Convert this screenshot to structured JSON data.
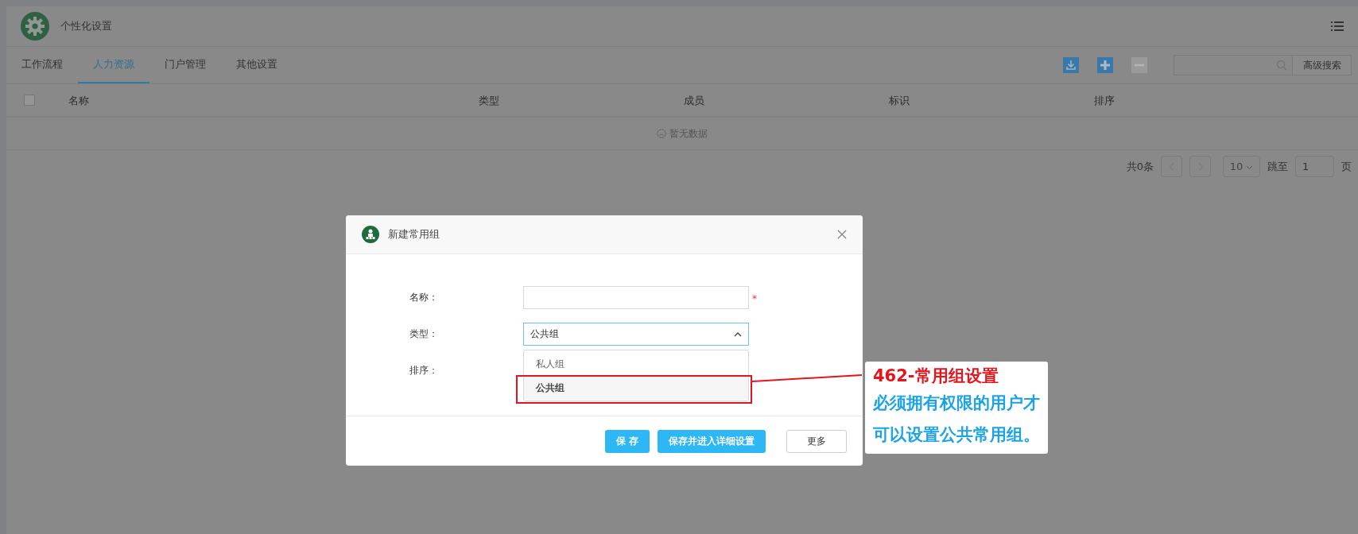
{
  "header": {
    "title": "个性化设置"
  },
  "tabs": [
    {
      "label": "工作流程",
      "selected": false
    },
    {
      "label": "人力资源",
      "selected": true
    },
    {
      "label": "门户管理",
      "selected": false
    },
    {
      "label": "其他设置",
      "selected": false
    }
  ],
  "toolbar": {
    "advanced_search": "高级搜索"
  },
  "table": {
    "select_all": {
      "checked": false
    },
    "columns": [
      "名称",
      "类型",
      "成员",
      "标识",
      "排序"
    ],
    "empty_text": "暂无数据"
  },
  "pagination": {
    "total": "共0条",
    "page_size": "10",
    "jump_label": "跳至",
    "page": "1",
    "page_suffix": "页"
  },
  "dialog": {
    "title": "新建常用组",
    "fields": [
      {
        "label": "名称：",
        "kind": "text",
        "required_mark": "*"
      },
      {
        "label": "类型：",
        "kind": "select",
        "value": "公共组",
        "expanded": true,
        "options": [
          {
            "label": "私人组",
            "selected": false
          },
          {
            "label": "公共组",
            "selected": true
          }
        ]
      },
      {
        "label": "排序：",
        "kind": "covered"
      }
    ],
    "buttons": [
      {
        "label": "保 存",
        "kind": "primary"
      },
      {
        "label": "保存并进入详细设置",
        "kind": "primary"
      },
      {
        "label": "更多",
        "kind": "plain"
      }
    ]
  },
  "annotation": {
    "title": "462-常用组设置",
    "lines": [
      "必须拥有权限的用户才",
      "可以设置公共常用组。"
    ]
  }
}
